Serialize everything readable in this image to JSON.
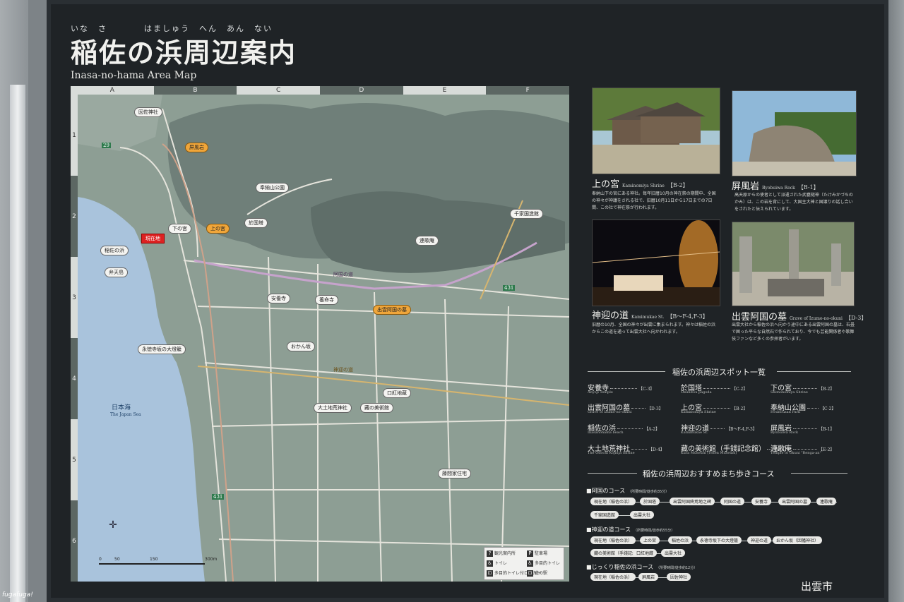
{
  "title": {
    "furigana": "いな　さ　　　　はましゅう　へん　あん　ない",
    "main": "稲佐の浜周辺案内",
    "sub": "Inasa-no-hama Area Map"
  },
  "map": {
    "columns": [
      "A",
      "B",
      "C",
      "D",
      "E",
      "F"
    ],
    "rows": [
      "1",
      "2",
      "3",
      "4",
      "5",
      "6"
    ],
    "sea_label_jp": "日本海",
    "sea_label_en": "The Japan Sea",
    "current_location": "現在地",
    "places": [
      {
        "id": "inasa-shrine",
        "name": "因佐神社"
      },
      {
        "id": "byobuiwa",
        "name": "屏風岩"
      },
      {
        "id": "hounou-park",
        "name": "奉納山公園"
      },
      {
        "id": "shimonomiya",
        "name": "下の宮"
      },
      {
        "id": "kaminomiya",
        "name": "上の宮"
      },
      {
        "id": "okunitou",
        "name": "於国塔"
      },
      {
        "id": "senge",
        "name": "千家国造館"
      },
      {
        "id": "rengean",
        "name": "連歌庵"
      },
      {
        "id": "inasanohama",
        "name": "稲佐の浜"
      },
      {
        "id": "bentenjima",
        "name": "弁天島"
      },
      {
        "id": "anyoji",
        "name": "安養寺"
      },
      {
        "id": "yoshinji",
        "name": "養命寺"
      },
      {
        "id": "okuni-grave",
        "name": "出雲阿国の墓"
      },
      {
        "id": "okanzaka",
        "name": "おかん坂"
      },
      {
        "id": "eitokuji",
        "name": "永徳寺坂の大燈籠"
      },
      {
        "id": "kuchibeni",
        "name": "口紅地蔵"
      },
      {
        "id": "daidokoro",
        "name": "大土地荒神社"
      },
      {
        "id": "kura",
        "name": "藏の美術館"
      },
      {
        "id": "fujima",
        "name": "藤間家住宅"
      }
    ],
    "road_labels": {
      "okuni_road": "阿国の道",
      "kamimukae_road": "神迎の道"
    },
    "route_numbers": [
      "29",
      "431",
      "431"
    ],
    "scale": [
      "0",
      "50",
      "150",
      "300m"
    ],
    "legend": [
      {
        "sym": "?",
        "text": "観光案内所"
      },
      {
        "sym": "P",
        "text": "駐車場"
      },
      {
        "sym": "♿",
        "text": "トイレ"
      },
      {
        "sym": "♿",
        "text": "多目的トイレ"
      },
      {
        "sym": "⊡",
        "text": "多目的トイレ付ロッカー"
      },
      {
        "sym": "⊡",
        "text": "道の駅"
      }
    ]
  },
  "photos": [
    {
      "name": "上の宮",
      "en": "Kaminomiya Shrine",
      "ref": "【B-2】",
      "desc": "奉納山下の宮にある神社。毎年旧暦10月の神在祭の期間中、全国の神々が神議をされる社で、旧暦10月11日から17日までの7日間、この社で神在祭が行われます。"
    },
    {
      "name": "屏風岩",
      "en": "Byobuiwa Rock",
      "ref": "【B-1】",
      "desc": "高天原からの使者として派遣された武甕槌神（たけみかづちのかみ）は、この岩を背にして、大国主大神と国譲りの話し合いをされたと伝えられています。"
    },
    {
      "name": "神迎の道",
      "en": "Kamimukae St.",
      "ref": "【B～F-4,F-3】",
      "desc": "旧暦の10月、全国の神々が出雲に集まられます。神々は稲佐の浜からこの道を通って出雲大社へ向かわれます。"
    },
    {
      "name": "出雲阿国の墓",
      "en": "Grave of Izumo-no-okuni",
      "ref": "【D-3】",
      "desc": "出雲大社から稲佐の浜へ向かう途中にある出雲阿国の墓は、石畳で囲った平らな自然石で作られており、今でも芸能関係者や歌舞伎ファンなど多くの参拝者がいます。"
    }
  ],
  "spot_list": {
    "title": "稲佐の浜周辺スポット一覧",
    "items": [
      {
        "name": "安養寺",
        "ref": "【C-3】",
        "en": "Anyoji Temple"
      },
      {
        "name": "於国塔",
        "ref": "【C-2】",
        "en": "Okunitou pagoda"
      },
      {
        "name": "下の宮",
        "ref": "【B-2】",
        "en": "Shimonomiya Shrine"
      },
      {
        "name": "出雲阿国の墓",
        "ref": "【D-3】",
        "en": "Grave of Izumo-no-okuni"
      },
      {
        "name": "上の宮",
        "ref": "【B-2】",
        "en": "Kaminomiya Shrine"
      },
      {
        "name": "奉納山公園",
        "ref": "【C-2】",
        "en": "Hounouzan Park"
      },
      {
        "name": "稲佐の浜",
        "ref": "【A-2】",
        "en": "Inasanohama beach"
      },
      {
        "name": "神迎の道",
        "ref": "【B～F-4,F-3】",
        "en": "Kamimukae St."
      },
      {
        "name": "屏風岩",
        "ref": "【B-1】",
        "en": "Byobuiwa Rock"
      },
      {
        "name": "大土地荒神社",
        "ref": "【D-4】",
        "en": "The Odochi Kojinja Shrine"
      },
      {
        "name": "藏の美術館（手錢記念館）",
        "ref": "【D-4】",
        "en": "Kura Museum (Tezen Museum)"
      },
      {
        "name": "連歌庵",
        "ref": "【E-2】",
        "en": "Temple of Okuni \"Renga-an\""
      }
    ]
  },
  "courses": {
    "title": "稲佐の浜周辺おすすめまち歩きコース",
    "list": [
      {
        "name": "阿国のコース",
        "time": "（所要時間/徒歩約35分）",
        "stops": [
          "現在地（稲佐の浜）",
          "於国塔",
          "出雲阿国終焉地之碑",
          "阿国の道",
          "安養寺",
          "出雲阿国の墓",
          "連歌庵",
          "千家国造館",
          "出雲大社"
        ]
      },
      {
        "name": "神迎の道コース",
        "time": "（所要時間/徒歩約55分）",
        "stops": [
          "現在地（稲佐の浜）",
          "上の宮",
          "稲佐の浜",
          "永徳寺坂下の大燈籠",
          "神迎の道",
          "おかん坂（因幡神社）",
          "藏の美術館（手錢記念館）",
          "口紅地蔵",
          "出雲大社"
        ]
      },
      {
        "name": "じっくり稲佐の浜コース",
        "time": "（所要時間/徒歩約12分）",
        "stops": [
          "現在地（稲佐の浜）",
          "屏風岩",
          "因佐神社"
        ]
      }
    ]
  },
  "city": "出雲市",
  "watermark": "fugafuga!"
}
